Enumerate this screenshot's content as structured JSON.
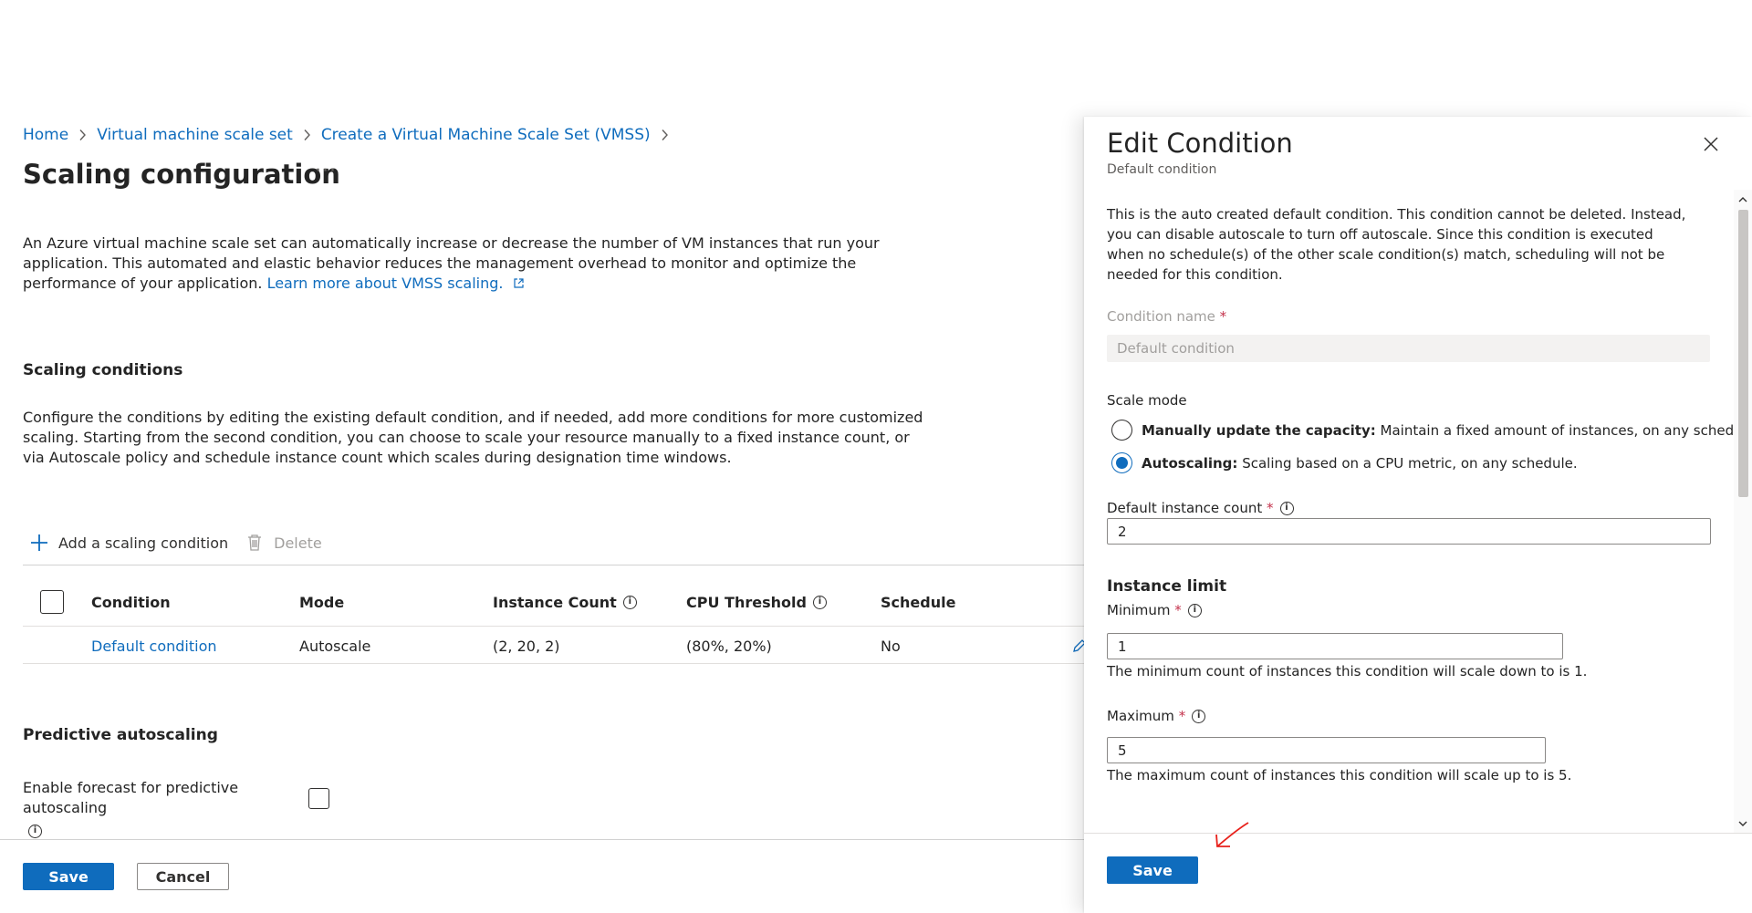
{
  "breadcrumb": {
    "items": [
      {
        "label": "Home"
      },
      {
        "label": "Virtual machine scale set"
      },
      {
        "label": "Create a Virtual Machine Scale Set (VMSS)"
      }
    ]
  },
  "page": {
    "title": "Scaling configuration",
    "more_icon": "more-horizontal-icon",
    "intro_text": "An Azure virtual machine scale set can automatically increase or decrease the number of VM instances that run your application. This automated and elastic behavior reduces the management overhead to monitor and optimize the performance of your application.",
    "intro_link": "Learn more about VMSS scaling."
  },
  "scaling_conditions": {
    "title": "Scaling conditions",
    "description": "Configure the conditions by editing the existing default condition, and if needed, add more conditions for more customized scaling. Starting from the second condition, you can choose to scale your resource manually to a fixed instance count, or via Autoscale policy and schedule instance count which scales during designation time windows.",
    "toolbar": {
      "add_label": "Add a scaling condition",
      "delete_label": "Delete"
    },
    "columns": [
      "Condition",
      "Mode",
      "Instance Count",
      "CPU Threshold",
      "Schedule"
    ],
    "rows": [
      {
        "condition": "Default condition",
        "mode": "Autoscale",
        "instance_count": "(2, 20, 2)",
        "cpu_threshold": "(80%, 20%)",
        "schedule": "No"
      }
    ]
  },
  "predictive": {
    "title": "Predictive autoscaling",
    "forecast_label": "Enable forecast for predictive autoscaling",
    "forecast_checked": false
  },
  "footer": {
    "save_label": "Save",
    "cancel_label": "Cancel"
  },
  "panel": {
    "title": "Edit Condition",
    "subtitle": "Default condition",
    "description": "This is the auto created default condition. This condition cannot be deleted. Instead, you can disable autoscale to turn off autoscale. Since this condition is executed when no schedule(s) of the other scale condition(s) match, scheduling will not be needed for this condition.",
    "condition_name_label": "Condition name",
    "condition_name_value": "Default condition",
    "scale_mode_label": "Scale mode",
    "mode_manual_bold": "Manually update the capacity:",
    "mode_manual_text": "Maintain a fixed amount of instances, on any schedule.",
    "mode_auto_bold": "Autoscaling:",
    "mode_auto_text": "Scaling based on a CPU metric, on any schedule.",
    "selected_mode": "autoscaling",
    "default_count_label": "Default instance count",
    "default_count_value": "2",
    "instance_limit_title": "Instance limit",
    "minimum_label": "Minimum",
    "minimum_value": "1",
    "minimum_help": "The minimum count of instances this condition will scale down to is 1.",
    "maximum_label": "Maximum",
    "maximum_value": "5",
    "maximum_help": "The maximum count of instances this condition will scale up to is 5.",
    "save_label": "Save",
    "required_marker": "*"
  },
  "colors": {
    "accent": "#0f6cbd",
    "required": "#c4314b",
    "annotation": "#e8211b"
  }
}
